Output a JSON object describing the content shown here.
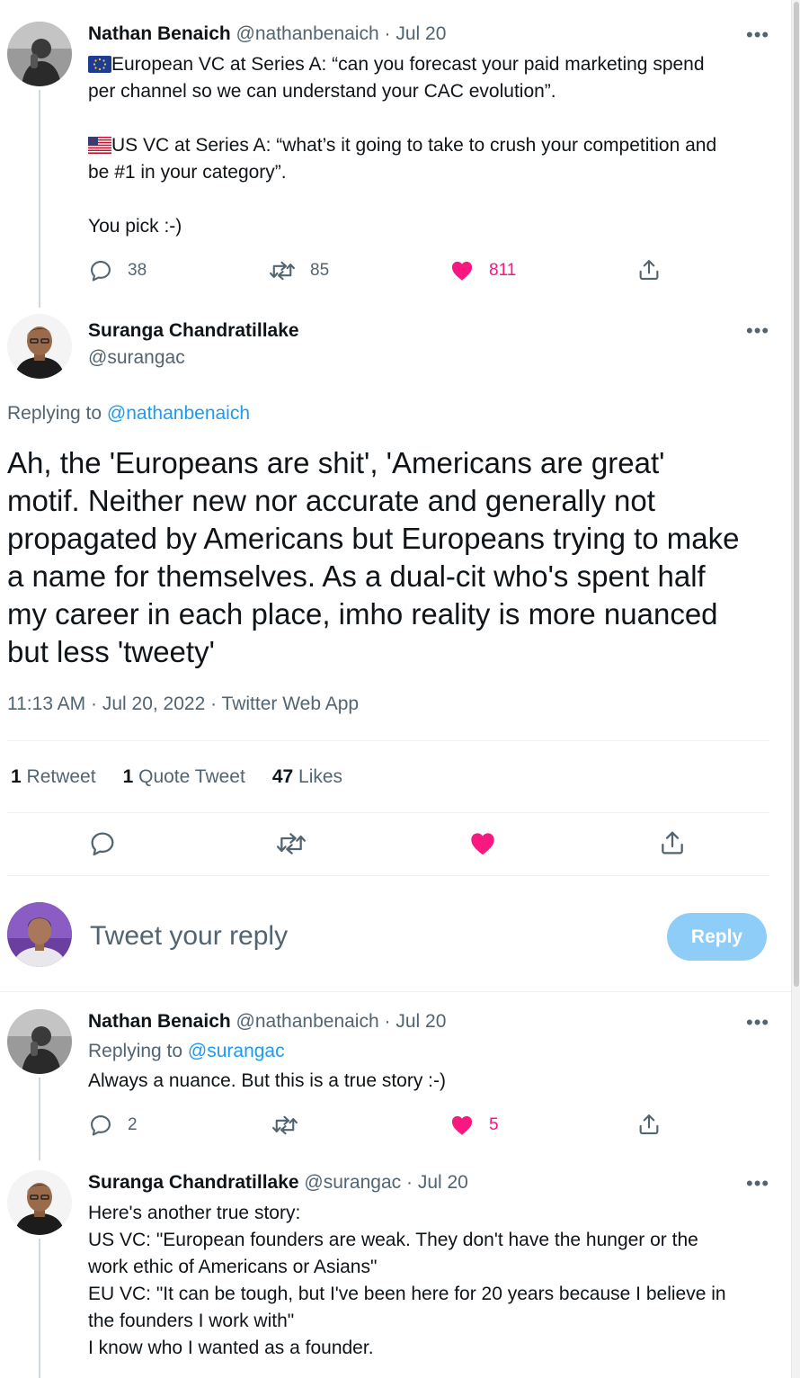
{
  "thread": {
    "parent": {
      "name": "Nathan Benaich",
      "handle": "@nathanbenaich",
      "dot": "·",
      "date": "Jul 20",
      "lines": [
        "European VC at Series A: “can you forecast your paid marketing spend",
        "per channel so we can understand your CAC evolution”.",
        "US VC at Series A: “what’s it going to take to crush your competition and",
        "be #1 in your category”.",
        "You pick :-)"
      ],
      "flags": {
        "eu": "EU flag emoji",
        "us": "US flag emoji"
      },
      "replies": "38",
      "retweets": "85",
      "likes": "811",
      "liked": true,
      "more_label": "•••"
    },
    "focused": {
      "name": "Suranga Chandratillake",
      "handle": "@surangac",
      "more_label": "•••",
      "replying_prefix": "Replying to",
      "replying_to": "@nathanbenaich",
      "lines": [
        "Ah, the 'Europeans are shit', 'Americans are great'",
        "motif. Neither new nor accurate and generally not",
        "propagated by Americans but Europeans trying to make",
        "a name for themselves. As a dual-cit who's spent half",
        "my career in each place, imho reality is more nuanced",
        "but less 'tweety'"
      ],
      "meta": "11:13 AM · Jul 20, 2022 · Twitter Web App",
      "stats": {
        "retweets_count": "1",
        "retweets_label": "Retweet",
        "quotes_count": "1",
        "quotes_label": "Quote Tweet",
        "likes_count": "47",
        "likes_label": "Likes"
      }
    },
    "composer": {
      "placeholder": "Tweet your reply",
      "button": "Reply"
    },
    "reply1": {
      "name": "Nathan Benaich",
      "handle": "@nathanbenaich",
      "dot": "·",
      "date": "Jul 20",
      "replying_prefix": "Replying to",
      "replying_to": "@surangac",
      "text": "Always a nuance. But this is a true story :-)",
      "replies": "2",
      "retweets": "",
      "likes": "5",
      "liked": true,
      "more_label": "•••"
    },
    "reply2": {
      "name": "Suranga Chandratillake",
      "handle": "@surangac",
      "dot": "·",
      "date": "Jul 20",
      "lines": [
        "Here's another true story:",
        "US VC: \"European founders are weak. They don't have the hunger or the",
        "work ethic of Americans or Asians\"",
        "EU VC: \"It can be tough, but I've been here for 20 years because I believe in",
        "the founders I work with\"",
        "I know who I wanted as a founder."
      ],
      "more_label": "•••"
    }
  },
  "colors": {
    "text": "#0f1419",
    "secondary": "#536471",
    "link": "#1d9bf0",
    "like": "#f91880",
    "reply_button": "#8ecdf8",
    "divider": "#eff3f4"
  },
  "icons": [
    "reply-icon",
    "retweet-icon",
    "like-icon",
    "share-icon",
    "eu-flag-icon",
    "us-flag-icon",
    "more-icon"
  ]
}
